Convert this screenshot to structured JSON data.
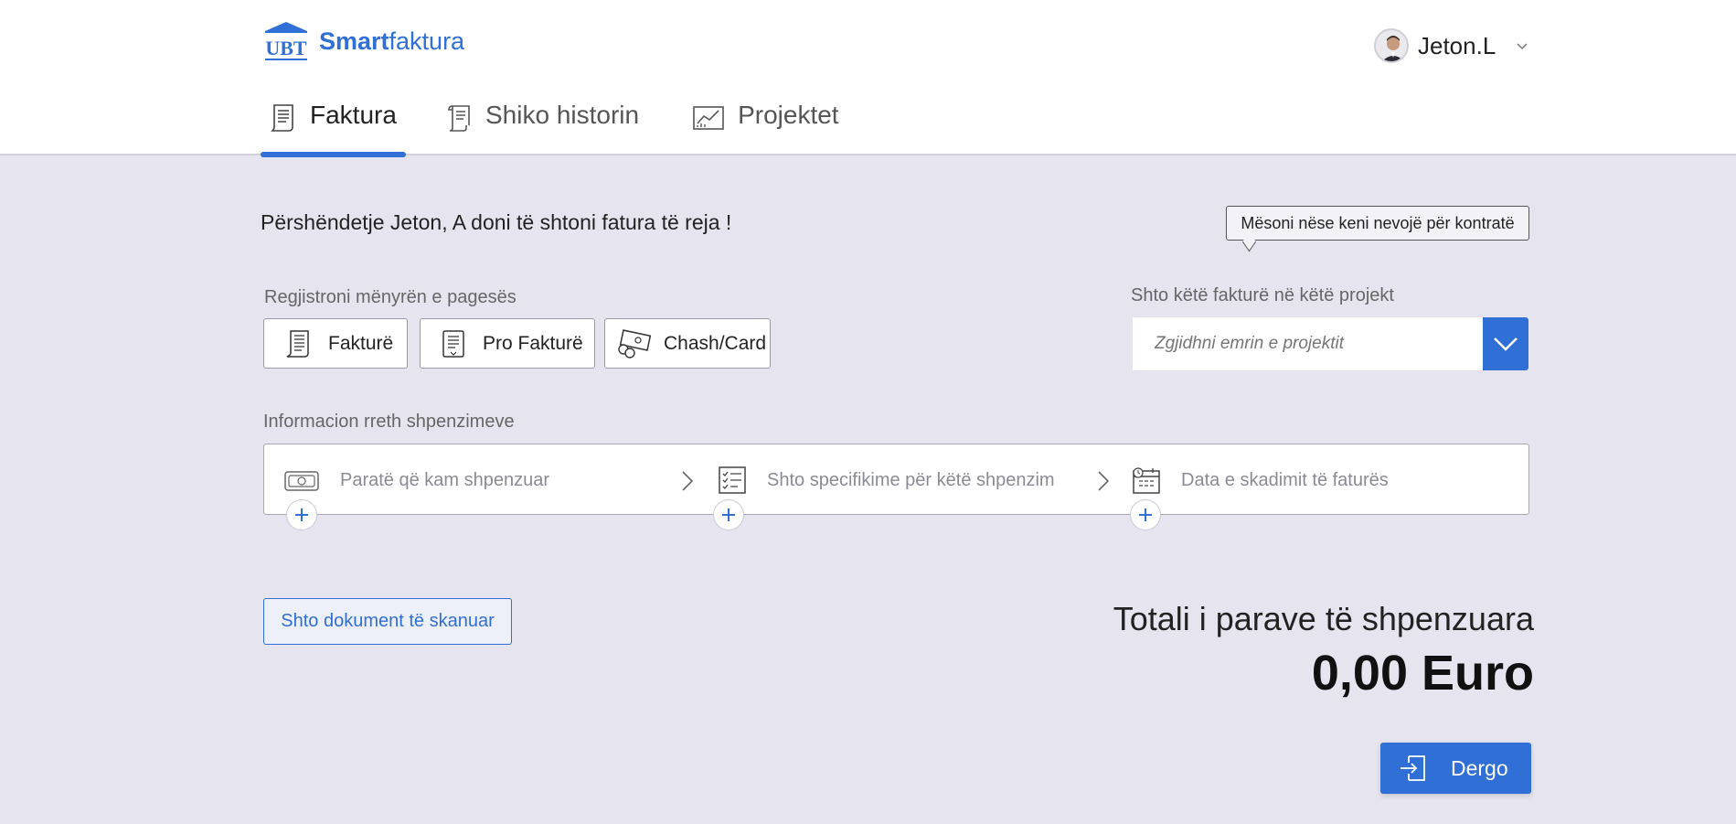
{
  "app": {
    "logo_mark": "UBT",
    "logo_bold": "Smart",
    "logo_light": "faktura"
  },
  "user": {
    "name": "Jeton.L"
  },
  "tabs": [
    {
      "label": "Faktura",
      "icon": "invoice-icon",
      "active": true
    },
    {
      "label": "Shiko historin",
      "icon": "scroll-icon",
      "active": false
    },
    {
      "label": "Projektet",
      "icon": "chart-icon",
      "active": false
    }
  ],
  "greeting": "Përshëndetje Jeton, A doni të shtoni fatura të reja !",
  "contract_hint": "Mësoni nëse keni nevojë për kontratë",
  "payment": {
    "label": "Regjistroni mënyrën e pagesës",
    "options": [
      {
        "label": "Fakturë",
        "icon": "invoice-icon"
      },
      {
        "label": "Pro Fakturë",
        "icon": "document-icon"
      },
      {
        "label": "Chash/Card",
        "icon": "cash-icon"
      }
    ]
  },
  "project": {
    "label": "Shto këtë fakturë në këtë projekt",
    "placeholder": "Zgjidhni emrin e projektit"
  },
  "expenses": {
    "label": "Informacion rreth shpenzimeve",
    "items": [
      {
        "label": "Paratë që kam shpenzuar",
        "icon": "money-icon"
      },
      {
        "label": "Shto specifikime për këtë shpenzim",
        "icon": "checklist-icon"
      },
      {
        "label": "Data e skadimit të faturës",
        "icon": "calendar-icon"
      }
    ]
  },
  "scan_button": "Shto dokument të skanuar",
  "total": {
    "label": "Totali i parave të shpenzuara",
    "value": "0,00 Euro"
  },
  "send_button": "Dergo",
  "colors": {
    "accent": "#2f6fd6",
    "background": "#e6e5ef"
  }
}
